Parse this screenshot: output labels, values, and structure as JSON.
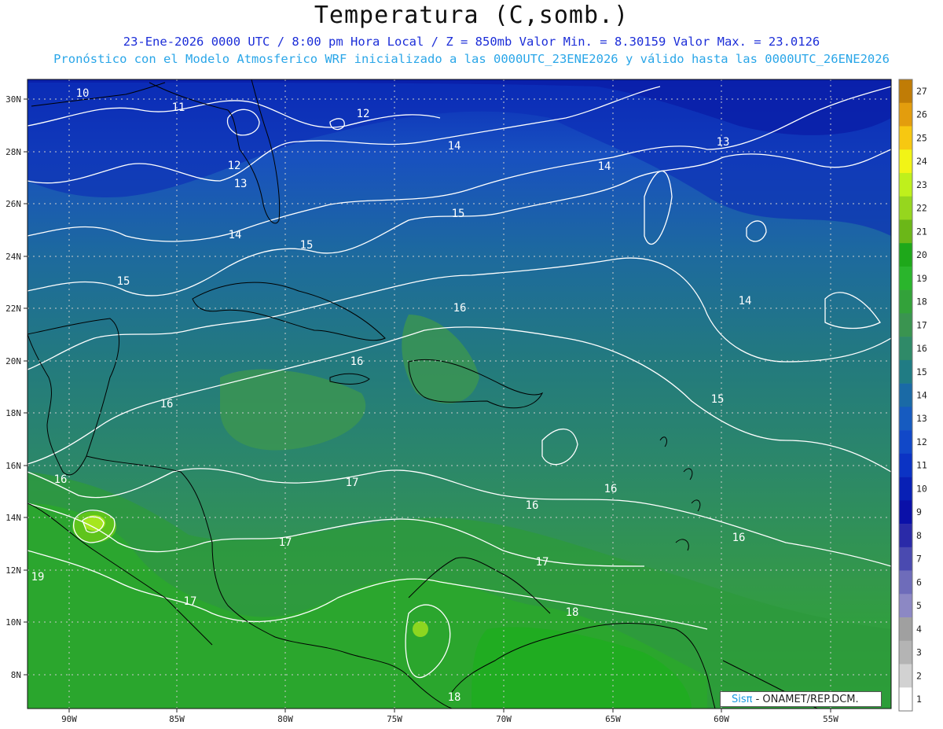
{
  "header": {
    "title": "Temperatura (C,somb.)",
    "line1": "23-Ene-2026  0000 UTC / 8:00 pm Hora Local / Z = 850mb    Valor Min. = 8.30159  Valor Max. = 23.0126",
    "line2": "Pronóstico con el Modelo Atmosferico WRF inicializado a las 0000UTC_23ENE2026 y válido hasta las  0000UTC_26ENE2026"
  },
  "map": {
    "lat_labels": [
      "30N",
      "28N",
      "26N",
      "24N",
      "22N",
      "20N",
      "18N",
      "16N",
      "14N",
      "12N",
      "10N",
      "8N"
    ],
    "lon_labels": [
      "90W",
      "85W",
      "80W",
      "75W",
      "70W",
      "65W",
      "60W",
      "55W"
    ],
    "contour_labels": [
      {
        "text": "10"
      },
      {
        "text": "11"
      },
      {
        "text": "12"
      },
      {
        "text": "12"
      },
      {
        "text": "13"
      },
      {
        "text": "14"
      },
      {
        "text": "14"
      },
      {
        "text": "13"
      },
      {
        "text": "14"
      },
      {
        "text": "15"
      },
      {
        "text": "15"
      },
      {
        "text": "15"
      },
      {
        "text": "16"
      },
      {
        "text": "14"
      },
      {
        "text": "16"
      },
      {
        "text": "16"
      },
      {
        "text": "15"
      },
      {
        "text": "16"
      },
      {
        "text": "17"
      },
      {
        "text": "16"
      },
      {
        "text": "16"
      },
      {
        "text": "16"
      },
      {
        "text": "17"
      },
      {
        "text": "17"
      },
      {
        "text": "19"
      },
      {
        "text": "17"
      },
      {
        "text": "18"
      },
      {
        "text": "18"
      }
    ]
  },
  "colorbar": {
    "levels": [
      "27",
      "26",
      "25",
      "24",
      "23",
      "22",
      "21",
      "20",
      "19",
      "18",
      "17",
      "16",
      "15",
      "14",
      "13",
      "12",
      "11",
      "10",
      "9",
      "8",
      "7",
      "6",
      "5",
      "4",
      "3",
      "2",
      "1"
    ],
    "colors": [
      "#c07c06",
      "#e39d0d",
      "#f7c811",
      "#f2f416",
      "#bff01c",
      "#96d61e",
      "#6bb718",
      "#1ea81a",
      "#2ab52c",
      "#33a23a",
      "#3a9450",
      "#2f8a68",
      "#207c84",
      "#1a6aa6",
      "#165bc0",
      "#1148c8",
      "#0b33c4",
      "#0820b5",
      "#0a10a8",
      "#2a2aa8",
      "#4a4ab0",
      "#6e6cba",
      "#8c88c4",
      "#a0a0a0",
      "#b4b4b4",
      "#d2d2d2",
      "#ffffff"
    ]
  },
  "credit": {
    "sis": "Sisπ",
    "text": " - ONAMET/REP.DCM."
  }
}
